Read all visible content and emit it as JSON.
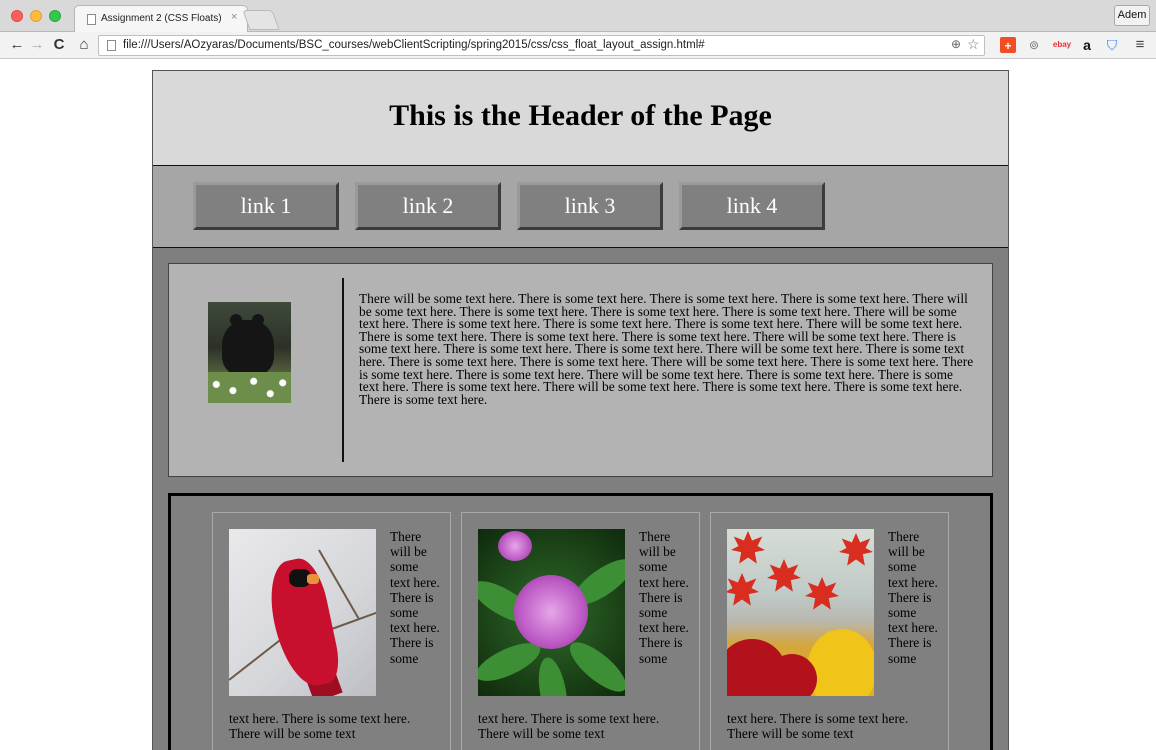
{
  "browser": {
    "tab_title": "Assignment 2 (CSS Floats)",
    "tab_close": "×",
    "profile_name": "Adem",
    "url": "file:///Users/AOzyaras/Documents/BSC_courses/webClientScripting/spring2015/css/css_float_layout_assign.html#",
    "icons": {
      "back": "←",
      "forward": "→",
      "reload": "C",
      "home": "⌂",
      "zoom": "⊕",
      "star": "☆",
      "plus": "+",
      "pin": "⊚",
      "ebay": "ebay",
      "amazon": "a",
      "shield": "⛉",
      "menu": "≡"
    }
  },
  "page": {
    "title": "This is the Header of the Page",
    "nav_links": [
      "link 1",
      "link 2",
      "link 3",
      "link 4"
    ],
    "intro_text": "There will be some text here. There is some text here. There is some text here. There is some text here. There will be some text here. There is some text here. There is some text here. There is some text here. There will be some text here. There is some text here. There is some text here. There is some text here. There will be some text here. There is some text here. There is some text here. There is some text here. There will be some text here. There is some text here. There is some text here. There is some text here. There will be some text here. There is some text here. There is some text here. There is some text here. There will be some text here. There is some text here. There is some text here. There is some text here. There will be some text here. There is some text here. There is some text here. There is some text here. There will be some text here. There is some text here. There is some text here. There is some text here.",
    "cards": [
      {
        "image": "cardinal-photo",
        "text_narrow": "There will be some text here. There is some text here. There is some",
        "text_wide": "text here. There is some text here. There will be some text"
      },
      {
        "image": "rhododendron-photo",
        "text_narrow": "There will be some text here. There is some text here. There is some",
        "text_wide": "text here. There is some text here. There will be some text"
      },
      {
        "image": "autumn-leaves-photo",
        "text_narrow": "There will be some text here. There is some text here. There is some",
        "text_wide": "text here. There is some text here. There will be some text"
      }
    ]
  }
}
